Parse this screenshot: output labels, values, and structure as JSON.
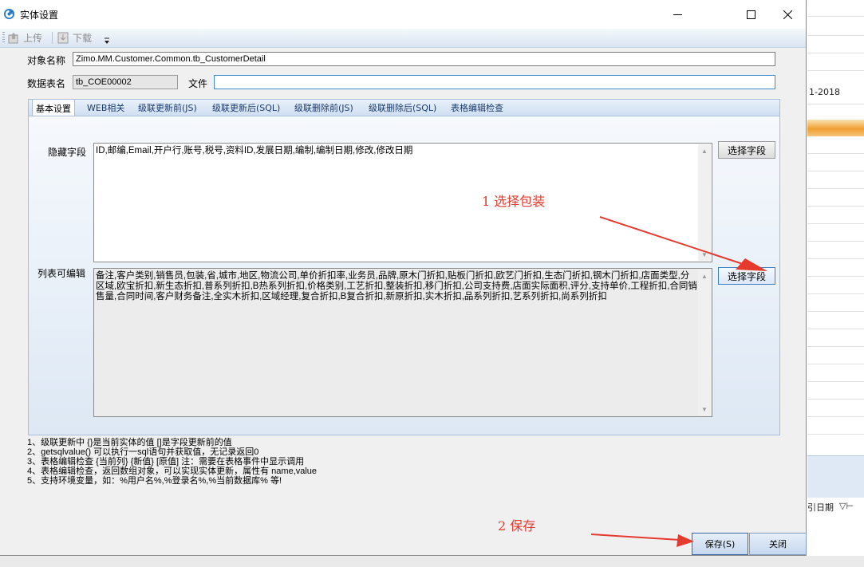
{
  "window": {
    "title": "实体设置"
  },
  "toolbar": {
    "upload": "上传",
    "download": "下载"
  },
  "form": {
    "object_name_label": "对象名称",
    "object_name_value": "Zimo.MM.Customer.Common.tb_CustomerDetail",
    "table_name_label": "数据表名",
    "table_name_value": "tb_COE00002",
    "file_label": "文件",
    "file_value": ""
  },
  "tabs": [
    "基本设置",
    "WEB相关",
    "级联更新前(JS)",
    "级联更新后(SQL)",
    "级联删除前(JS)",
    "级联删除后(SQL)",
    "表格编辑检查"
  ],
  "panel": {
    "hidden_fields_label": "隐藏字段",
    "hidden_fields_value": "ID,邮编,Email,开户行,账号,税号,资料ID,发展日期,编制,编制日期,修改,修改日期",
    "editable_label": "列表可编辑",
    "editable_value": "备注,客户类别,销售员,包装,省,城市,地区,物流公司,单价折扣率,业务员,品牌,原木门折扣,贴板门折扣,欧艺门折扣,生态门折扣,钢木门折扣,店面类型,分区域,欧宝折扣,新生态折扣,普系列折扣,B热系列折扣,价格类别,工艺折扣,整装折扣,移门折扣,公司支持费,店面实际面积,评分,支持单价,工程折扣,合同销售量,合同时间,客户财务备注,全实木折扣,区域经理,复合折扣,B复合折扣,新原折扣,实木折扣,品系列折扣,艺系列折扣,尚系列折扣",
    "select_field_button": "选择字段"
  },
  "notes": [
    "1、级联更新中 {}是当前实体的值 []是字段更新前的值",
    "2、getsqlvalue() 可以执行一sql语句并获取值，无记录返回0",
    "3、表格编辑检查 {当前列} {新值} [原值] 注：需要在表格事件中显示调用",
    "4、表格编辑检查，返回数组对象，可以实现实体更新，属性有 name,value",
    "5、支持环境变量，如：%用户名%,%登录名%,%当前数据库% 等!"
  ],
  "buttons": {
    "save": "保存(S)",
    "close": "关闭"
  },
  "annotations": {
    "step1": "1 选择包装",
    "step2": "2 保存"
  },
  "background": {
    "date_text": "1-2018",
    "column_header": "引日期"
  },
  "colors": {
    "annotation_red": "#e53a2e",
    "panel_blue": "#dde8f4",
    "accent_orange": "#f0a032"
  }
}
